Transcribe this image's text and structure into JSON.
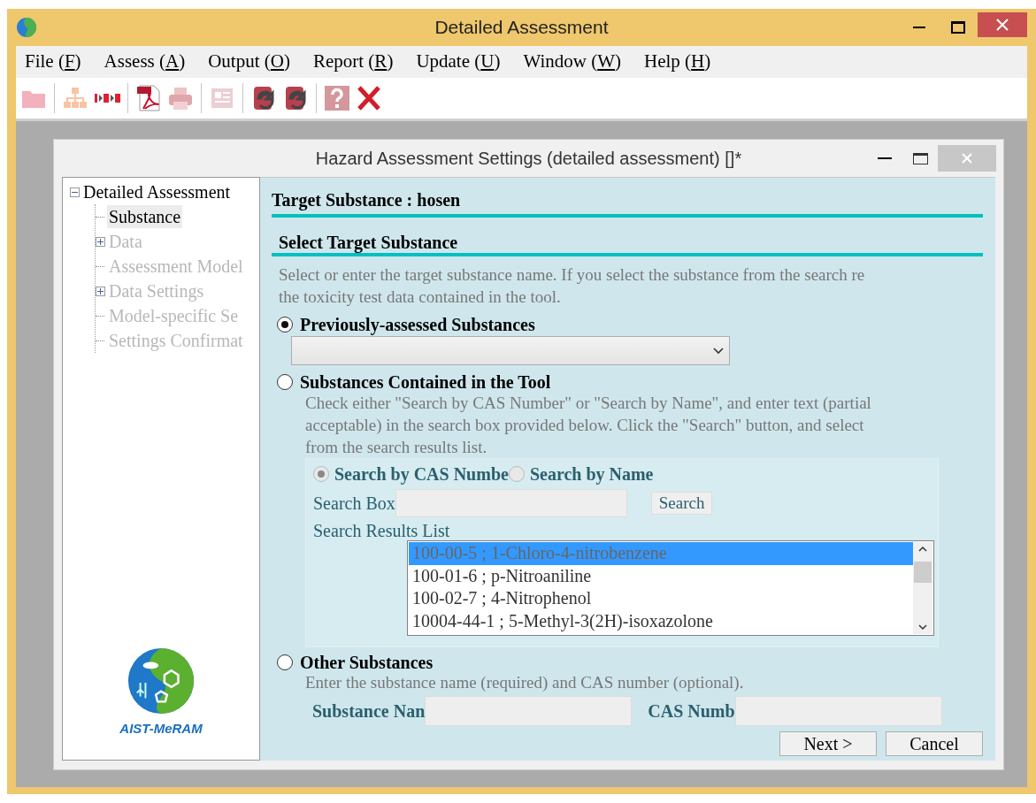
{
  "window": {
    "title": "Detailed Assessment"
  },
  "menu": [
    {
      "before": "File (",
      "key": "F",
      "after": ")"
    },
    {
      "before": "Assess (",
      "key": "A",
      "after": ")"
    },
    {
      "before": "Output (",
      "key": "O",
      "after": ")"
    },
    {
      "before": "Report (",
      "key": "R",
      "after": ")"
    },
    {
      "before": "Update (",
      "key": "U",
      "after": ")"
    },
    {
      "before": "Window (",
      "key": "W",
      "after": ")"
    },
    {
      "before": "Help (",
      "key": "H",
      "after": ")"
    }
  ],
  "toolbar": [
    {
      "kind": "folder",
      "disabled": true
    },
    {
      "kind": "separator"
    },
    {
      "kind": "hierarchy",
      "disabled": true
    },
    {
      "kind": "steps",
      "disabled": false
    },
    {
      "kind": "separator"
    },
    {
      "kind": "pdf",
      "disabled": false
    },
    {
      "kind": "printer",
      "disabled": true
    },
    {
      "kind": "separator"
    },
    {
      "kind": "document",
      "disabled": true
    },
    {
      "kind": "separator"
    },
    {
      "kind": "sync",
      "disabled": false
    },
    {
      "kind": "sync2",
      "disabled": false
    },
    {
      "kind": "separator"
    },
    {
      "kind": "help",
      "disabled": true
    },
    {
      "kind": "close",
      "disabled": false
    }
  ],
  "dialog": {
    "title": "Hazard Assessment Settings (detailed assessment) []*",
    "tree": [
      {
        "label": "Detailed Assessment",
        "expanded": true,
        "selected": false,
        "disabled": false,
        "children": [
          {
            "label": "Substance",
            "selected": true,
            "disabled": false
          },
          {
            "label": "Data",
            "expanded": false,
            "selected": false,
            "disabled": true
          },
          {
            "label": "Assessment Model",
            "selected": false,
            "disabled": true
          },
          {
            "label": "Data Settings",
            "expanded": false,
            "selected": false,
            "disabled": true
          },
          {
            "label": "Model-specific Se",
            "selected": false,
            "disabled": true
          },
          {
            "label": "Settings Confirmat",
            "selected": false,
            "disabled": true
          }
        ]
      }
    ],
    "logo_text": "AIST-MeRAM",
    "target_heading": "Target Substance : hosen",
    "section_heading": "Select Target Substance",
    "intro": "Select or enter the target substance name. If you select the substance from the search re\nthe toxicity test data contained in the tool.",
    "options": [
      {
        "kind": "previous",
        "label": "Previously-assessed Substances",
        "selected": true
      },
      {
        "kind": "tool",
        "label": "Substances Contained in the Tool",
        "selected": false,
        "help": "Check either \"Search by CAS Number\" or \"Search by Name\", and enter text (partial\nacceptable) in the search box provided below. Click the \"Search\" button, and select\nfrom the search results list.",
        "search_modes": [
          {
            "label": "Search by CAS Numbe",
            "selected": true
          },
          {
            "label": "Search by Name",
            "selected": false
          }
        ],
        "search_box_label": "Search Box",
        "search_button": "Search",
        "results_label": "Search Results List",
        "results": [
          {
            "label": "100-00-5 ; 1-Chloro-4-nitrobenzene",
            "selected": true
          },
          {
            "label": "100-01-6 ; p-Nitroaniline",
            "selected": false
          },
          {
            "label": "100-02-7 ; 4-Nitrophenol",
            "selected": false
          },
          {
            "label": "10004-44-1 ; 5-Methyl-3(2H)-isoxazolone",
            "selected": false
          }
        ]
      },
      {
        "kind": "other",
        "label": "Other Substances",
        "selected": false,
        "help": "Enter the substance name (required) and CAS number (optional).",
        "name_label": "Substance Nan",
        "cas_label": "CAS Numb"
      }
    ],
    "buttons": [
      "Next >",
      "Cancel"
    ]
  }
}
